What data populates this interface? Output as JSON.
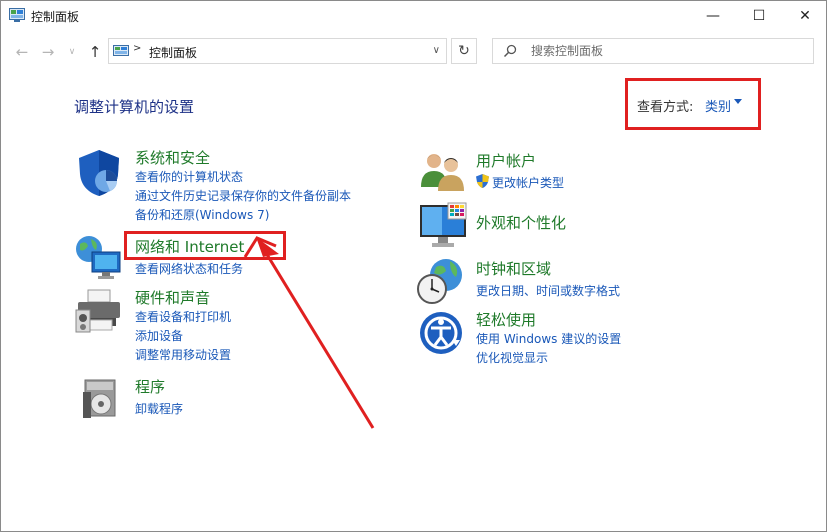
{
  "window": {
    "title": "控制面板",
    "minimize_symbol": "—",
    "maximize_symbol": "☐",
    "close_symbol": "✕"
  },
  "navigation": {
    "back_symbol": "←",
    "forward_symbol": "→",
    "recent_symbol": "∨",
    "up_symbol": "↑",
    "address_separator": ">",
    "address_text": "控制面板",
    "address_dropdown_symbol": "∨",
    "refresh_symbol": "↻",
    "search_placeholder": "搜索控制面板"
  },
  "header": {
    "page_title": "调整计算机的设置",
    "view_by_label": "查看方式:",
    "view_by_value": "类别"
  },
  "left_categories": [
    {
      "title": "系统和安全",
      "icon": "shield-icon",
      "links": [
        "查看你的计算机状态",
        "通过文件历史记录保存你的文件备份副本",
        "备份和还原(Windows 7)"
      ]
    },
    {
      "title": "网络和 Internet",
      "icon": "network-icon",
      "links": [
        "查看网络状态和任务"
      ]
    },
    {
      "title": "硬件和声音",
      "icon": "printer-icon",
      "links": [
        "查看设备和打印机",
        "添加设备",
        "调整常用移动设置"
      ]
    },
    {
      "title": "程序",
      "icon": "programs-icon",
      "links": [
        "卸载程序"
      ]
    }
  ],
  "right_categories": [
    {
      "title": "用户帐户",
      "icon": "users-icon",
      "links": [
        "更改帐户类型"
      ]
    },
    {
      "title": "外观和个性化",
      "icon": "display-icon",
      "links": []
    },
    {
      "title": "时钟和区域",
      "icon": "clock-globe-icon",
      "links": [
        "更改日期、时间或数字格式"
      ]
    },
    {
      "title": "轻松使用",
      "icon": "accessibility-icon",
      "links": [
        "使用 Windows 建议的设置",
        "优化视觉显示"
      ]
    }
  ],
  "colors": {
    "category_title": "#1f7a2a",
    "link": "#1a58b8",
    "annotation_red": "#e02020",
    "page_title": "#1e3287"
  }
}
